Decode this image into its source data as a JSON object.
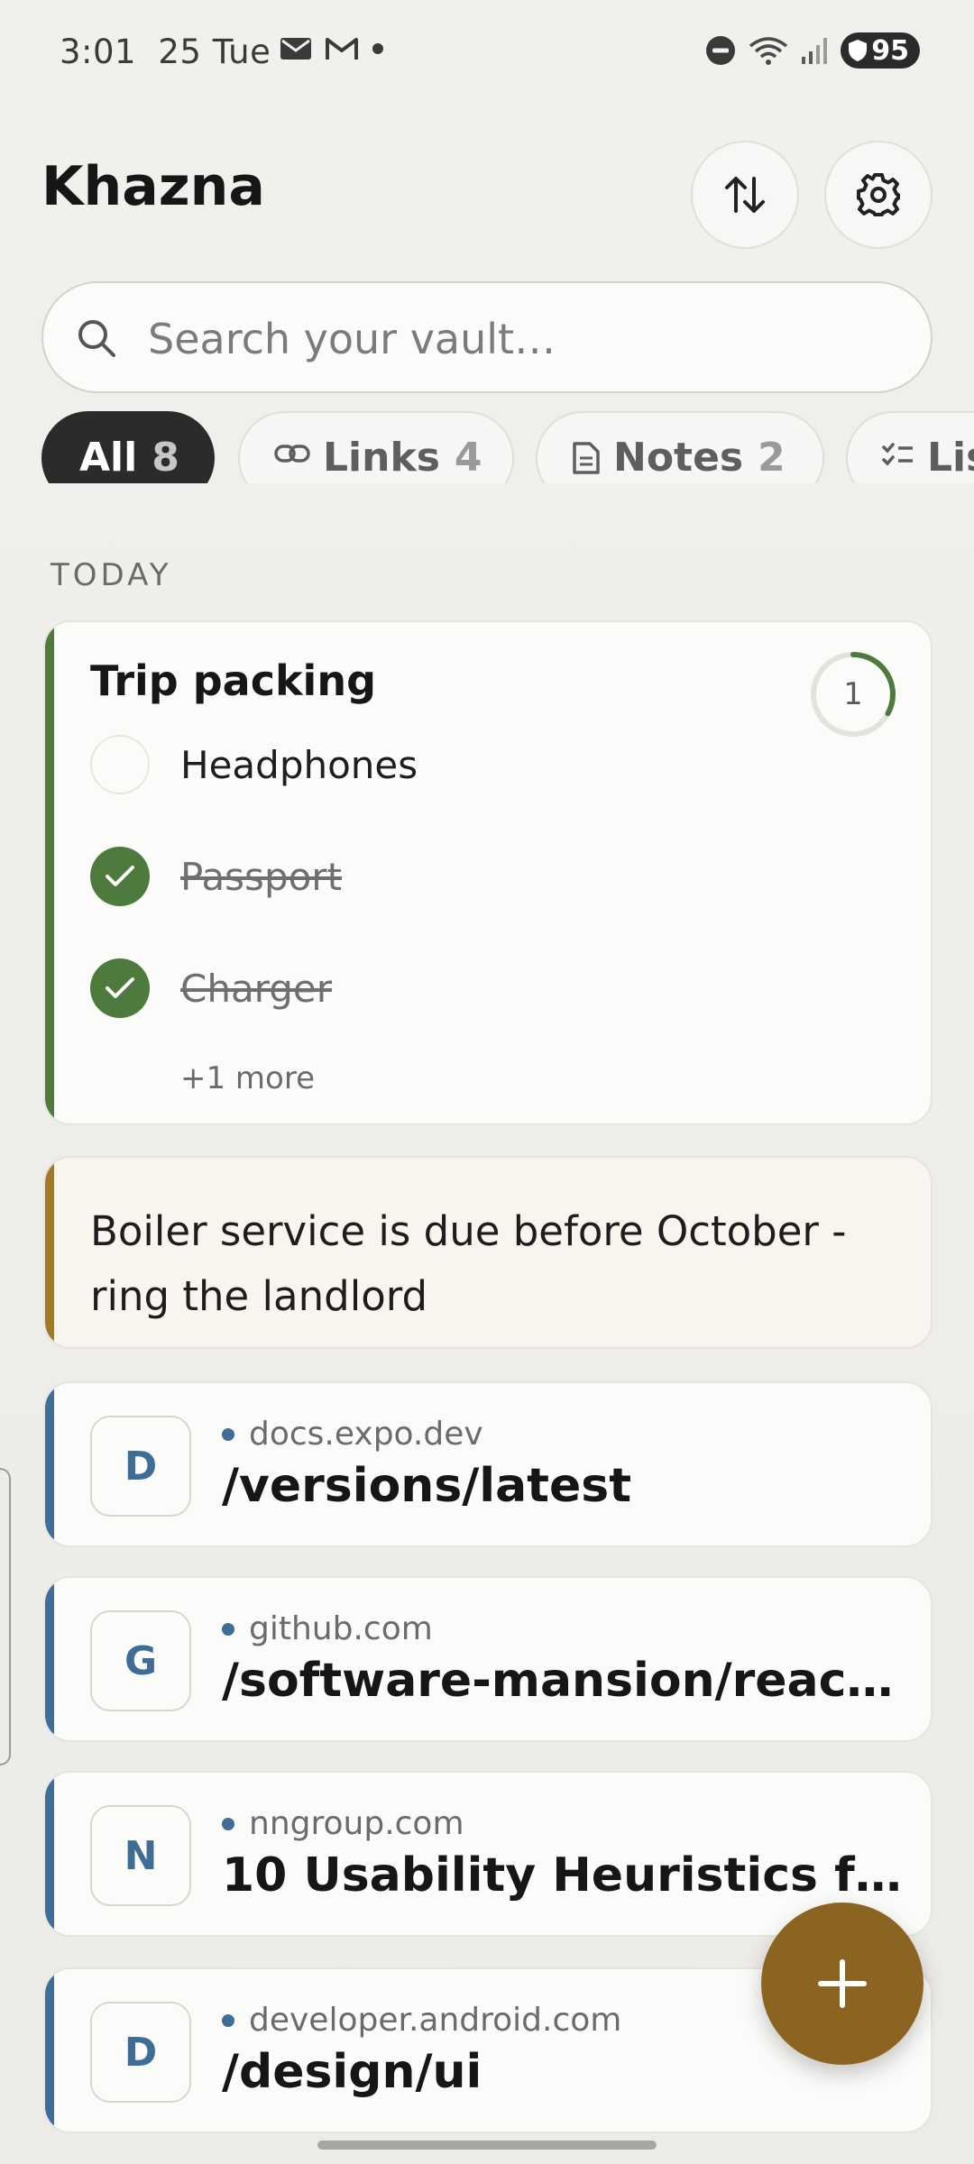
{
  "status_bar": {
    "time": "3:01",
    "date": "25 Tue",
    "battery": "95"
  },
  "header": {
    "title": "Khazna"
  },
  "search": {
    "placeholder": "Search your vault…"
  },
  "filters": [
    {
      "label": "All",
      "count": "8",
      "active": true
    },
    {
      "label": "Links",
      "count": "4",
      "icon": "link-icon"
    },
    {
      "label": "Notes",
      "count": "2",
      "icon": "document-icon"
    },
    {
      "label": "Lis",
      "icon": "checklist-icon"
    }
  ],
  "section": {
    "label": "TODAY"
  },
  "checklist_card": {
    "title": "Trip packing",
    "progress_count": "1",
    "progress_fraction": 0.33,
    "accent_color": "#4e7a3d",
    "items": [
      {
        "label": "Headphones",
        "checked": false
      },
      {
        "label": "Passport",
        "checked": true
      },
      {
        "label": "Charger",
        "checked": true
      }
    ],
    "more": "+1 more"
  },
  "note_card": {
    "text": "Boiler service is due before October - ring the landlord",
    "accent_color": "#a07a2a"
  },
  "links": [
    {
      "initial": "D",
      "domain": "docs.expo.dev",
      "title": "/versions/latest"
    },
    {
      "initial": "G",
      "domain": "github.com",
      "title": "/software-mansion/reac…"
    },
    {
      "initial": "N",
      "domain": "nngroup.com",
      "title": "10 Usability Heuristics fo…"
    },
    {
      "initial": "D",
      "domain": "developer.android.com",
      "title": "/design/ui"
    }
  ],
  "colors": {
    "link_accent": "#3f6d96",
    "fab": "#8a6420",
    "active_chip": "#2b2b2b"
  }
}
